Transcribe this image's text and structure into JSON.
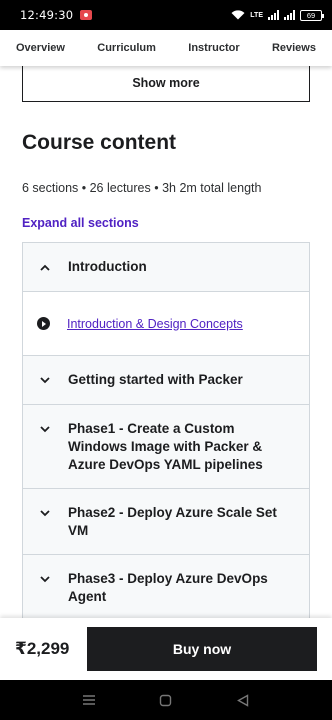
{
  "status_bar": {
    "time": "12:49:30",
    "network_label": "LTE",
    "battery": "69"
  },
  "tabs": [
    "Overview",
    "Curriculum",
    "Instructor",
    "Reviews"
  ],
  "show_more_label": "Show more",
  "course_content": {
    "heading": "Course content",
    "summary": "6 sections • 26 lectures • 3h 2m total length",
    "expand_all_label": "Expand all sections"
  },
  "sections": [
    {
      "title": "Introduction",
      "expanded": true,
      "lectures": [
        "Introduction & Design Concepts"
      ]
    },
    {
      "title": "Getting started with Packer",
      "expanded": false
    },
    {
      "title": "Phase1 - Create a Custom Windows Image with Packer & Azure DevOps YAML pipelines",
      "expanded": false
    },
    {
      "title": "Phase2 - Deploy Azure Scale Set VM",
      "expanded": false
    },
    {
      "title": "Phase3 - Deploy Azure DevOps Agent",
      "expanded": false
    }
  ],
  "purchase": {
    "price": "₹2,299",
    "buy_label": "Buy now"
  },
  "colors": {
    "accent_purple": "#5022c3",
    "dark": "#1c1d1f",
    "section_bg": "#f7f9fa",
    "border": "#d1d7dc"
  }
}
